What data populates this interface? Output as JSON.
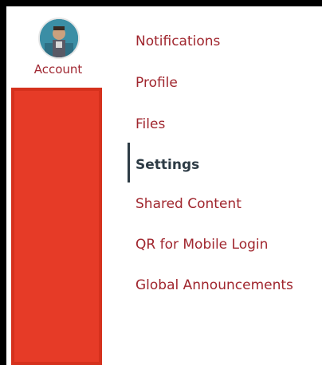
{
  "colors": {
    "brand": "#a0262e",
    "active_text": "#2d3b45",
    "rail_highlight": "#e63b27"
  },
  "global_nav": {
    "account_label": "Account",
    "avatar_icon": "user-avatar"
  },
  "account_menu": {
    "items": [
      {
        "label": "Notifications"
      },
      {
        "label": "Profile"
      },
      {
        "label": "Files"
      },
      {
        "label": "Settings",
        "active": true
      },
      {
        "label": "Shared Content"
      },
      {
        "label": "QR for Mobile Login"
      },
      {
        "label": "Global Announcements"
      }
    ]
  }
}
